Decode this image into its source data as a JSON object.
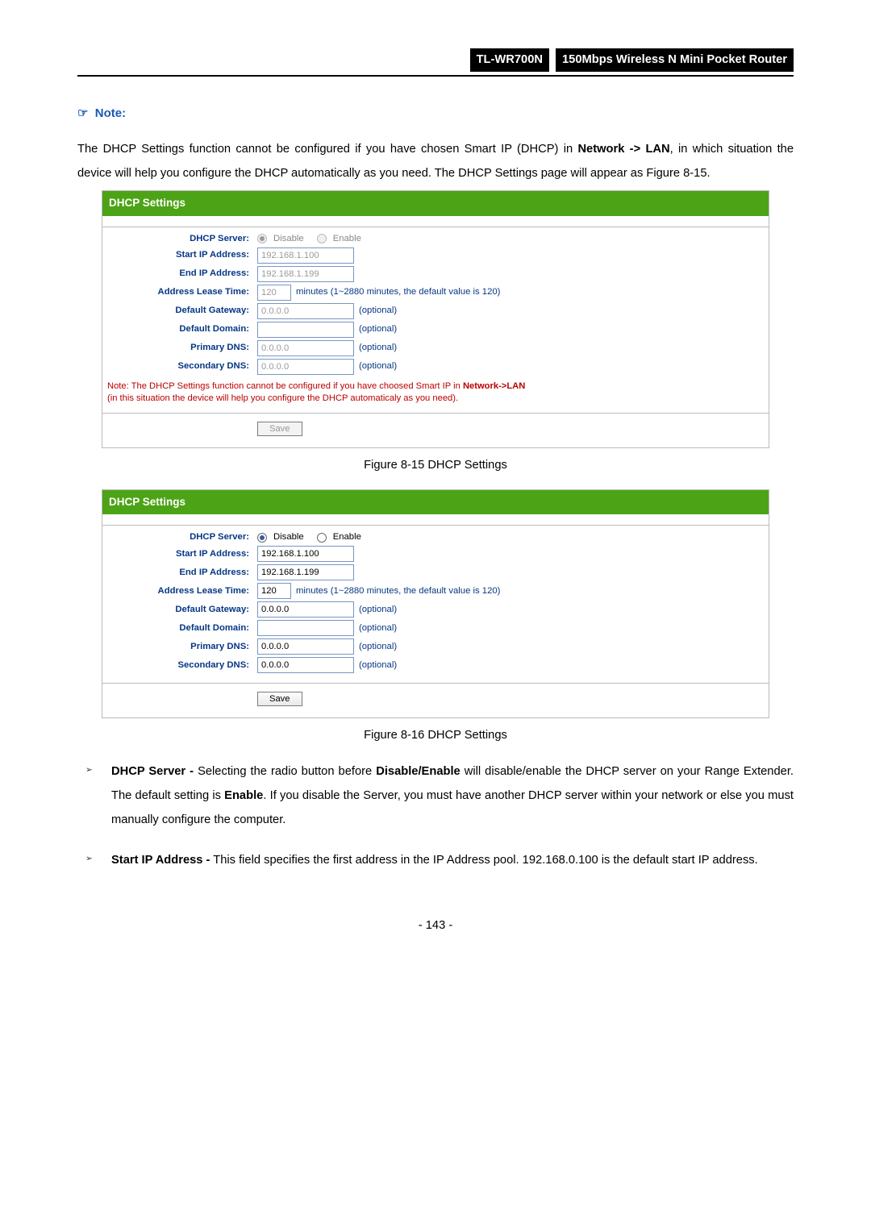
{
  "header": {
    "model": "TL-WR700N",
    "desc": "150Mbps Wireless N Mini Pocket Router"
  },
  "note": {
    "icon": "☞",
    "label": "Note:",
    "text_before": "The DHCP Settings function cannot be configured if you have chosen Smart IP (DHCP) in ",
    "path": "Network -> LAN",
    "text_after": ", in which situation the device will help you configure the DHCP automatically as you need. The DHCP Settings page will appear as Figure 8-15."
  },
  "labels": {
    "dhcp_server": "DHCP Server:",
    "start_ip": "Start IP Address:",
    "end_ip": "End IP Address:",
    "lease": "Address Lease Time:",
    "gateway": "Default Gateway:",
    "domain": "Default Domain:",
    "pdns": "Primary DNS:",
    "sdns": "Secondary DNS:",
    "disable": "Disable",
    "enable": "Enable",
    "lease_hint": "minutes (1~2880 minutes, the default value is 120)",
    "optional": "(optional)",
    "save": "Save"
  },
  "panel_disabled": {
    "title": "DHCP Settings",
    "start_ip": "192.168.1.100",
    "end_ip": "192.168.1.199",
    "lease": "120",
    "gateway": "0.0.0.0",
    "domain": "",
    "pdns": "0.0.0.0",
    "sdns": "0.0.0.0",
    "warn_prefix": "Note: The DHCP Settings function cannot be configured if you have choosed Smart IP in ",
    "warn_link": "Network->LAN",
    "warn_suffix": "(in this situation the device will help you configure the DHCP automaticaly as you need)."
  },
  "captions": {
    "c1": "Figure 8-15 DHCP Settings",
    "c2": "Figure 8-16 DHCP Settings"
  },
  "panel_enabled": {
    "title": "DHCP Settings",
    "start_ip": "192.168.1.100",
    "end_ip": "192.168.1.199",
    "lease": "120",
    "gateway": "0.0.0.0",
    "domain": "",
    "pdns": "0.0.0.0",
    "sdns": "0.0.0.0"
  },
  "bullets": {
    "b1_strong": "DHCP Server -",
    "b1_a": " Selecting the radio button before ",
    "b1_mid_strong": "Disable/Enable",
    "b1_b": " will disable/enable the DHCP server on your Range Extender. The default setting is ",
    "b1_enable_strong": "Enable",
    "b1_c": ". If you disable the Server, you must have another DHCP server within your network or else you must manually configure the computer.",
    "b2_strong": "Start IP Address -",
    "b2": " This field specifies the first address in the IP Address pool. 192.168.0.100 is the default start IP address."
  },
  "page_number": "- 143 -"
}
